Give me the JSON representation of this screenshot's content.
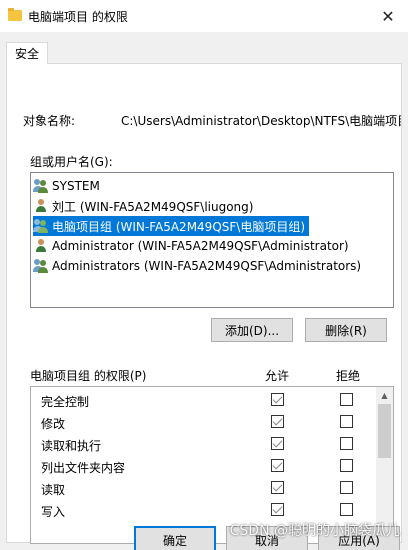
{
  "window": {
    "title": "电脑端项目 的权限",
    "close_glyph": "✕"
  },
  "tabs": [
    {
      "label": "安全",
      "selected": true
    }
  ],
  "object": {
    "label": "对象名称:",
    "value": "C:\\Users\\Administrator\\Desktop\\NTFS\\电脑端项目"
  },
  "users": {
    "label": "组或用户名(G):",
    "items": [
      {
        "name": "SYSTEM",
        "icon": "group-icon",
        "selected": false
      },
      {
        "name": "刘工 (WIN-FA5A2M49QSF\\liugong)",
        "icon": "user-icon",
        "selected": false
      },
      {
        "name": "电脑项目组 (WIN-FA5A2M49QSF\\电脑项目组)",
        "icon": "group-icon",
        "selected": true
      },
      {
        "name": "Administrator (WIN-FA5A2M49QSF\\Administrator)",
        "icon": "user-icon",
        "selected": false
      },
      {
        "name": "Administrators (WIN-FA5A2M49QSF\\Administrators)",
        "icon": "group-icon",
        "selected": false
      }
    ]
  },
  "buttons": {
    "add": "添加(D)...",
    "remove": "删除(R)"
  },
  "permissions": {
    "label": "电脑项目组 的权限(P)",
    "allow_label": "允许",
    "deny_label": "拒绝",
    "rows": [
      {
        "name": "完全控制",
        "allow": true,
        "deny": false
      },
      {
        "name": "修改",
        "allow": true,
        "deny": false
      },
      {
        "name": "读取和执行",
        "allow": true,
        "deny": false
      },
      {
        "name": "列出文件夹内容",
        "allow": true,
        "deny": false
      },
      {
        "name": "读取",
        "allow": true,
        "deny": false
      },
      {
        "name": "写入",
        "allow": true,
        "deny": false
      }
    ]
  },
  "footer": {
    "ok": "确定",
    "cancel": "取消",
    "apply": "应用(A)"
  },
  "watermark": "CSDN @聪明的小脑袋瓜儿",
  "colors": {
    "accent": "#0078d7",
    "folder": "#f5c542",
    "group_icon": "#5a8a3a",
    "user_icon": "#3c7a3c"
  }
}
